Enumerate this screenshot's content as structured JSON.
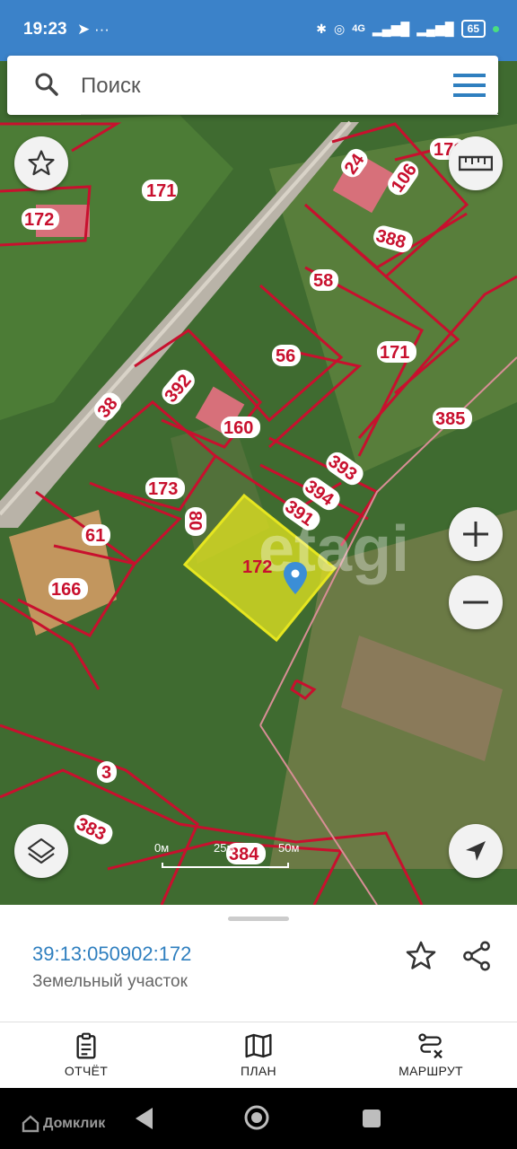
{
  "status": {
    "time": "19:23",
    "left_icons": "telegram-icon more-icon",
    "right_icons": "bluetooth wifi volte 4G signal signal",
    "network": "4G",
    "battery": "65"
  },
  "search": {
    "placeholder": "Поиск"
  },
  "map": {
    "parcel_labels": [
      "171",
      "172",
      "24",
      "106",
      "171",
      "388",
      "58",
      "56",
      "171",
      "392",
      "160",
      "38",
      "385",
      "393",
      "394",
      "173",
      "391",
      "80",
      "61",
      "172",
      "166",
      "3",
      "383",
      "384"
    ],
    "selected_parcel": "172",
    "watermark": "etagi",
    "scale": {
      "l0": "0м",
      "l1": "25м",
      "l2": "50м"
    }
  },
  "sheet": {
    "cadastral_number": "39:13:050902:172",
    "type": "Земельный участок"
  },
  "tabs": [
    {
      "label": "ОТЧЁТ",
      "icon": "report-icon"
    },
    {
      "label": "ПЛАН",
      "icon": "map-icon"
    },
    {
      "label": "МАРШРУТ",
      "icon": "route-icon"
    }
  ],
  "navbar": {
    "brand": "Домклик"
  },
  "colors": {
    "accent": "#2f7fbf",
    "status_bar": "#3b82c9",
    "parcel_border": "#c8102e",
    "selected_fill": "#e6e620"
  }
}
